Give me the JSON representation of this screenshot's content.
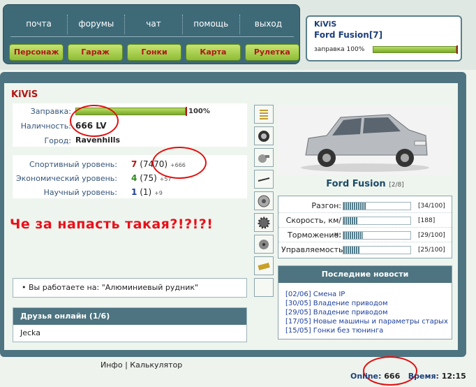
{
  "nav": {
    "top_links": [
      "почта",
      "форумы",
      "чат",
      "помощь",
      "выход"
    ],
    "buttons": [
      "Персонаж",
      "Гараж",
      "Гонки",
      "Карта",
      "Рулетка"
    ]
  },
  "user_box": {
    "name": "KiViS",
    "car": "Ford Fusion[7]",
    "fuel_label": "заправка 100%",
    "fuel_level": 1.0
  },
  "profile": {
    "name": "KiViS",
    "fuel_label": "Заправка:",
    "fuel_value": "100%",
    "fuel_level": 1.0,
    "cash_label": "Наличность:",
    "cash_value": "666 LV",
    "city_label": "Город:",
    "city_value": "Ravenhills",
    "levels": [
      {
        "label": "Спортивный уровень:",
        "level": "7",
        "points": "(7470)",
        "delta": "+666",
        "color": "red"
      },
      {
        "label": "Экономический уровень:",
        "level": "4",
        "points": "(75)",
        "delta": "+57",
        "color": "green"
      },
      {
        "label": "Научный уровень:",
        "level": "1",
        "points": "(1)",
        "delta": "+9",
        "color": "blue"
      }
    ]
  },
  "annotation": "Че за напасть такая?!?!?!",
  "work": {
    "bullet": "•",
    "text": "Вы работаете на: \"Алюминиевый рудник\""
  },
  "friends": {
    "title": "Друзья онлайн (1/6)",
    "items": [
      "Jecka"
    ]
  },
  "tuning_icons": [
    "spring-icon",
    "tire-icon",
    "turbo-icon",
    "wiper-icon",
    "brake-disc-icon",
    "gear-icon",
    "engine-part-icon",
    "battery-icon",
    "empty-slot"
  ],
  "car": {
    "name": "Ford Fusion",
    "slot": "[2/8]",
    "body_color": "#b8bcc0",
    "specs": [
      {
        "label": "Разгон:",
        "value": "[34/100]",
        "level": 0.34
      },
      {
        "label": "Скорость, км/ч:",
        "value": "[188]",
        "level": 0.22
      },
      {
        "label": "Торможение:",
        "value": "[29/100]",
        "level": 0.29
      },
      {
        "label": "Управляемость:",
        "value": "[25/100]",
        "level": 0.25
      }
    ]
  },
  "news": {
    "title": "Последние новости",
    "items": [
      "[02/06] Смена IP",
      "[30/05] Владение приводом",
      "[29/05] Владение приводом",
      "[17/05] Новые машины и параметры старых",
      "[15/05] Гонки без тюнинга"
    ]
  },
  "footer": {
    "info": "Инфо",
    "separator": "|",
    "calculator": "Калькулятор",
    "online_label": "Online:",
    "online_value": "666",
    "time_label": "Время:",
    "time_value": "12:15"
  }
}
